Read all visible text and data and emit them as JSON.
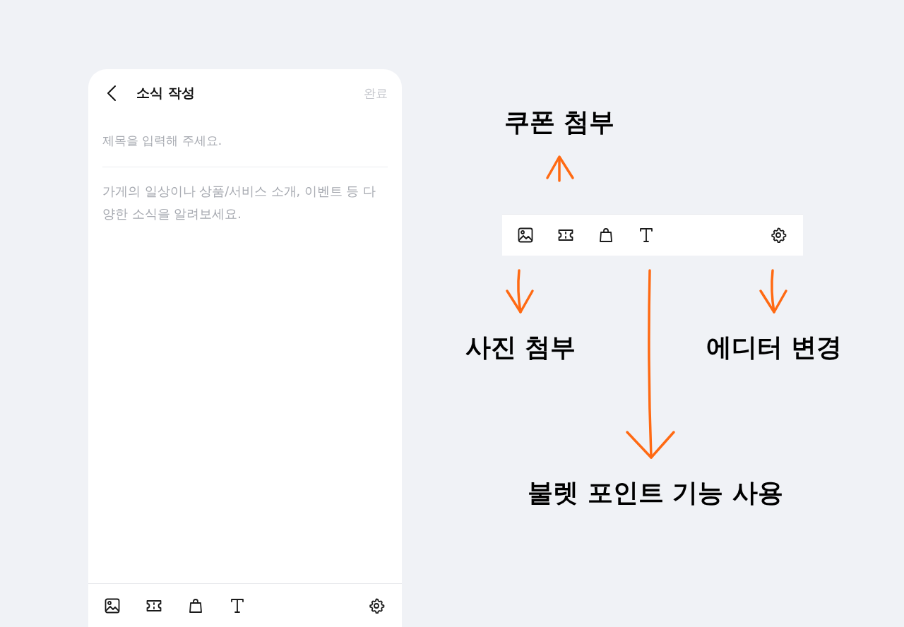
{
  "editor": {
    "title": "소식 작성",
    "done_button": "완료",
    "title_field": {
      "placeholder": "제목을 입력해 주세요."
    },
    "body_field": {
      "placeholder": "가게의 일상이나 상품/서비스 소개, 이벤트 등 다양한 소식을 알려보세요."
    },
    "toolbar": [
      {
        "kind": "image"
      },
      {
        "kind": "coupon"
      },
      {
        "kind": "bag"
      },
      {
        "kind": "text"
      },
      {
        "kind": "settings"
      }
    ]
  },
  "annotation_toolbar": [
    {
      "kind": "image"
    },
    {
      "kind": "coupon"
    },
    {
      "kind": "bag"
    },
    {
      "kind": "text"
    },
    {
      "kind": "settings"
    }
  ],
  "annotations": [
    {
      "text": "쿠폰 첨부",
      "kind": "up"
    },
    {
      "text": "사진 첨부",
      "kind": "down"
    },
    {
      "text": "에디터 변경",
      "kind": "down"
    },
    {
      "text": "불렛 포인트 기능 사용",
      "kind": "down"
    }
  ]
}
